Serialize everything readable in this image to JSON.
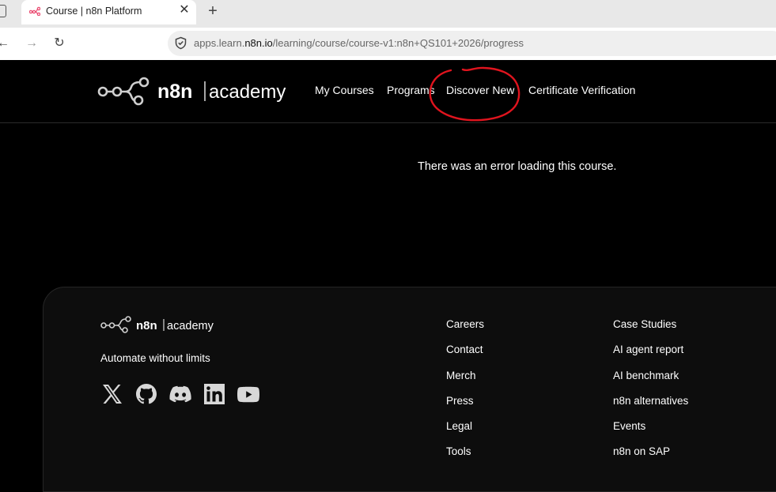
{
  "browser": {
    "tab_title": "Course | n8n Platform",
    "tab_close": "✕",
    "new_tab": "+",
    "back": "←",
    "forward": "→",
    "reload": "↻",
    "url_prefix": "apps.learn.",
    "url_host": "n8n.io",
    "url_path": "/learning/course/course-v1:n8n+QS101+2026/progress"
  },
  "header": {
    "logo_brand": "n8n",
    "logo_product": "academy",
    "nav": [
      {
        "label": "My Courses"
      },
      {
        "label": "Programs"
      },
      {
        "label": "Discover New"
      },
      {
        "label": "Certificate Verification"
      }
    ]
  },
  "main": {
    "error_message": "There was an error loading this course."
  },
  "footer": {
    "logo_brand": "n8n",
    "logo_product": "academy",
    "tagline": "Automate without limits",
    "socials": [
      "x-icon",
      "github-icon",
      "discord-icon",
      "linkedin-icon",
      "youtube-icon"
    ],
    "col1": [
      "Careers",
      "Contact",
      "Merch",
      "Press",
      "Legal",
      "Tools"
    ],
    "col2": [
      "Case Studies",
      "AI agent report",
      "AI benchmark",
      "n8n alternatives",
      "Events",
      "n8n on SAP"
    ]
  },
  "colors": {
    "annotation": "#e0141e",
    "background": "#000000",
    "footer_bg": "#0d0d0d"
  }
}
